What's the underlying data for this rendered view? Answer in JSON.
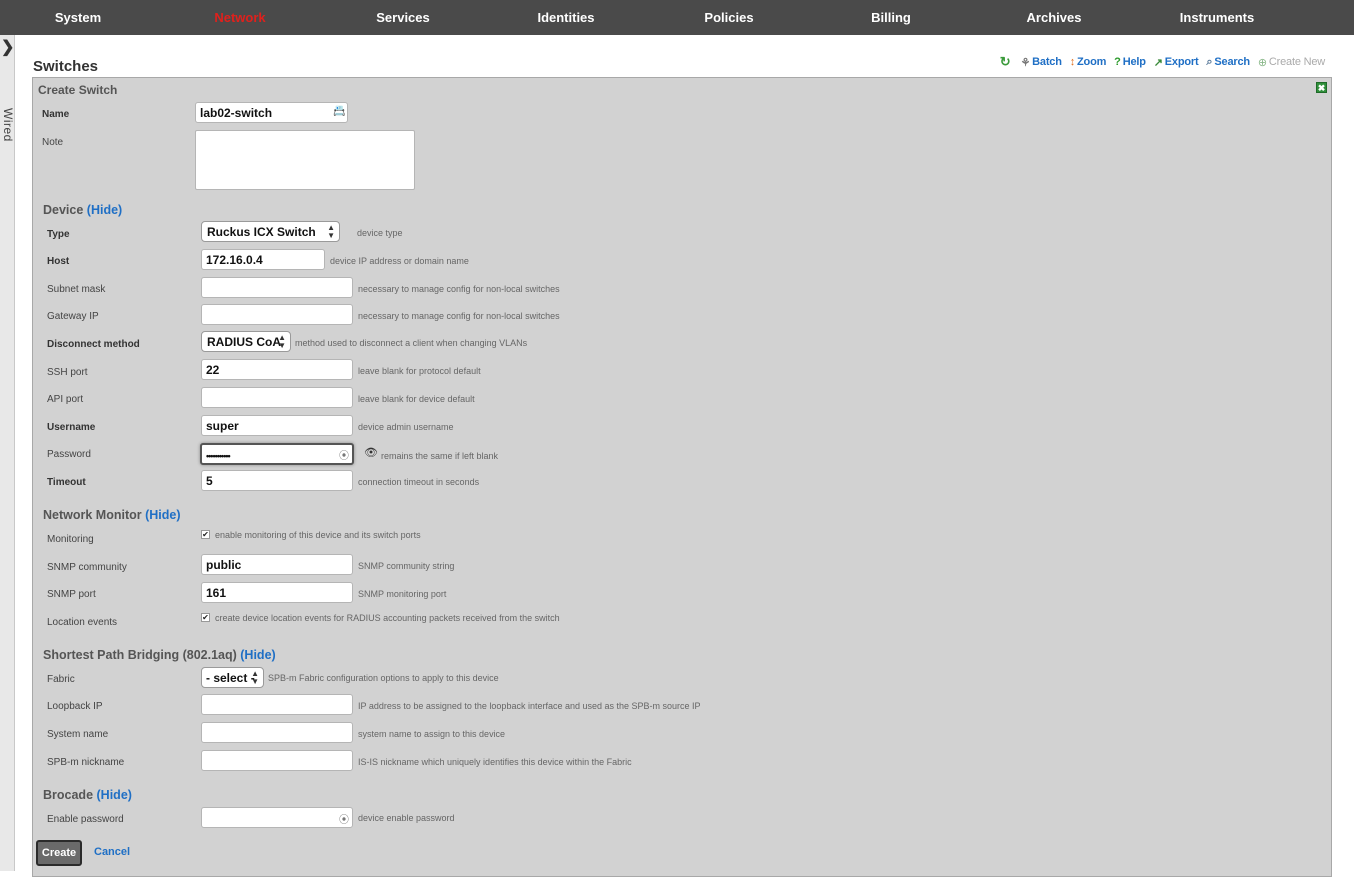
{
  "nav": {
    "items": [
      {
        "label": "System"
      },
      {
        "label": "Network"
      },
      {
        "label": "Services"
      },
      {
        "label": "Identities"
      },
      {
        "label": "Policies"
      },
      {
        "label": "Billing"
      },
      {
        "label": "Archives"
      },
      {
        "label": "Instruments"
      }
    ],
    "active": "Network"
  },
  "side": {
    "label": "Wired"
  },
  "page": {
    "title": "Switches"
  },
  "toolbar": {
    "batch": "Batch",
    "zoom": "Zoom",
    "help": "Help",
    "export": "Export",
    "search": "Search",
    "create_new": "Create New"
  },
  "form": {
    "title": "Create Switch",
    "name": {
      "label": "Name",
      "value": "lab02-switch"
    },
    "note": {
      "label": "Note",
      "value": ""
    },
    "device": {
      "section": "Device",
      "hide": "(Hide)",
      "type": {
        "label": "Type",
        "value": "Ruckus ICX Switch",
        "hint": "device type"
      },
      "host": {
        "label": "Host",
        "value": "172.16.0.4",
        "hint": "device IP address or domain name"
      },
      "subnet": {
        "label": "Subnet mask",
        "value": "",
        "hint": "necessary to manage config for non-local switches"
      },
      "gateway": {
        "label": "Gateway IP",
        "value": "",
        "hint": "necessary to manage config for non-local switches"
      },
      "disconnect": {
        "label": "Disconnect method",
        "value": "RADIUS CoA",
        "hint": "method used to disconnect a client when changing VLANs"
      },
      "ssh_port": {
        "label": "SSH port",
        "value": "22",
        "hint": "leave blank for protocol default"
      },
      "api_port": {
        "label": "API port",
        "value": "",
        "hint": "leave blank for device default"
      },
      "username": {
        "label": "Username",
        "value": "super",
        "hint": "device admin username"
      },
      "password": {
        "label": "Password",
        "value": "•••••••••••",
        "hint": "remains the same if left blank"
      },
      "timeout": {
        "label": "Timeout",
        "value": "5",
        "hint": "connection timeout in seconds"
      }
    },
    "monitor": {
      "section": "Network Monitor",
      "hide": "(Hide)",
      "monitoring": {
        "label": "Monitoring",
        "checked": true,
        "hint": "enable monitoring of this device and its switch ports"
      },
      "community": {
        "label": "SNMP community",
        "value": "public",
        "hint": "SNMP community string"
      },
      "snmp_port": {
        "label": "SNMP port",
        "value": "161",
        "hint": "SNMP monitoring port"
      },
      "location": {
        "label": "Location events",
        "checked": true,
        "hint": "create device location events for RADIUS accounting packets received from the switch"
      }
    },
    "spb": {
      "section": "Shortest Path Bridging (802.1aq)",
      "hide": "(Hide)",
      "fabric": {
        "label": "Fabric",
        "value": "- select -",
        "hint": "SPB-m Fabric configuration options to apply to this device"
      },
      "loopback": {
        "label": "Loopback IP",
        "value": "",
        "hint": "IP address to be assigned to the loopback interface and used as the SPB-m source IP"
      },
      "sysname": {
        "label": "System name",
        "value": "",
        "hint": "system name to assign to this device"
      },
      "nickname": {
        "label": "SPB-m nickname",
        "value": "",
        "hint": "IS-IS nickname which uniquely identifies this device within the Fabric"
      }
    },
    "brocade": {
      "section": "Brocade",
      "hide": "(Hide)",
      "enable_pw": {
        "label": "Enable password",
        "value": "",
        "hint": "device enable password"
      }
    },
    "create": "Create",
    "cancel": "Cancel"
  }
}
